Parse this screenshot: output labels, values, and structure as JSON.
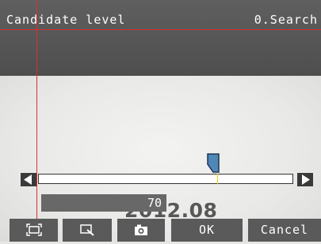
{
  "header": {
    "title": "Candidate level",
    "right_label": "0.Search"
  },
  "image": {
    "text": "2012.08"
  },
  "slider": {
    "value": "70",
    "position_fraction": 0.7
  },
  "toolbar": {
    "fit_icon": "fit-frame-icon",
    "zoom_icon": "zoom-icon",
    "camera_icon": "camera-icon",
    "ok_label": "OK",
    "cancel_label": "Cancel"
  },
  "colors": {
    "accent_red": "#d83030",
    "thumb_blue": "#4f87b8",
    "tick_yellow": "#e8d000"
  }
}
